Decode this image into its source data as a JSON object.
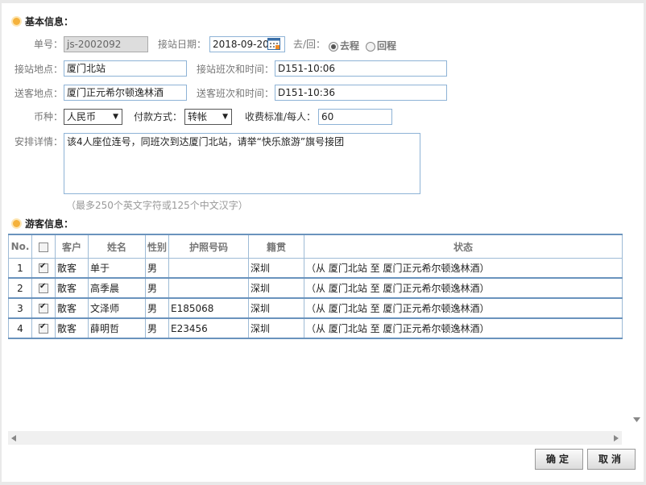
{
  "sections": {
    "basic": "基本信息：",
    "tourists": "游客信息："
  },
  "form": {
    "order_no_label": "单号：",
    "order_no": "js-2002092",
    "pickup_date_label": "接站日期：",
    "pickup_date": "2018-09-20",
    "direction_label": "去/回：",
    "direction_out": "去程",
    "direction_back": "回程",
    "direction_selected": "去程",
    "pickup_place_label": "接站地点：",
    "pickup_place": "厦门北站",
    "pickup_train_label": "接站班次和时间：",
    "pickup_train": "D151-10:06",
    "dropoff_place_label": "送客地点：",
    "dropoff_place": "厦门正元希尔顿逸林酒",
    "dropoff_train_label": "送客班次和时间：",
    "dropoff_train": "D151-10:36",
    "currency_label": "币种：",
    "currency": "人民币",
    "payment_label": "付款方式：",
    "payment": "转帐",
    "fee_label": "收费标准/每人：",
    "fee": "60",
    "details_label": "安排详情：",
    "details": "该4人座位连号，同班次到达厦门北站，请举“快乐旅游”旗号接团",
    "details_hint": "（最多250个英文字符或125个中文汉字）"
  },
  "table": {
    "headers": [
      "No.",
      "",
      "客户",
      "姓名",
      "性别",
      "护照号码",
      "籍贯",
      "状态"
    ],
    "rows": [
      {
        "no": "1",
        "checked": true,
        "client": "散客",
        "name": "单于",
        "gender": "男",
        "passport": "",
        "origin": "深圳",
        "status": "（从 厦门北站 至 厦门正元希尔顿逸林酒）"
      },
      {
        "no": "2",
        "checked": true,
        "client": "散客",
        "name": "高季晨",
        "gender": "男",
        "passport": "",
        "origin": "深圳",
        "status": "（从 厦门北站 至 厦门正元希尔顿逸林酒）"
      },
      {
        "no": "3",
        "checked": true,
        "client": "散客",
        "name": "文泽师",
        "gender": "男",
        "passport": "E185068",
        "origin": "深圳",
        "status": "（从 厦门北站 至 厦门正元希尔顿逸林酒）"
      },
      {
        "no": "4",
        "checked": true,
        "client": "散客",
        "name": "薛明哲",
        "gender": "男",
        "passport": "E23456",
        "origin": "深圳",
        "status": "（从 厦门北站 至 厦门正元希尔顿逸林酒）"
      }
    ]
  },
  "buttons": {
    "confirm": "确定",
    "cancel": "取消"
  },
  "icons": {
    "section": "sun-bullet-icon",
    "calendar": "calendar-icon",
    "dropdown": "triangle-down-icon"
  },
  "colors": {
    "input_border": "#8eb3d6",
    "table_border": "#6a93bd",
    "bullet": "#f5b23c"
  }
}
